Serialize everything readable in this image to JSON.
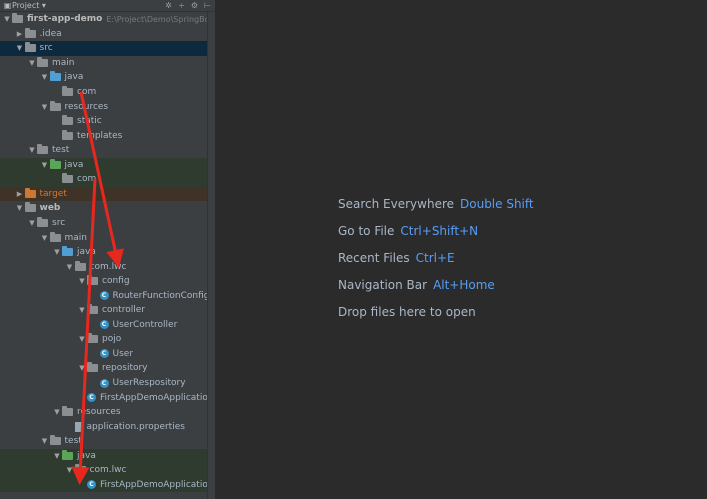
{
  "panel": {
    "title": "Project",
    "toolbar_icons": [
      "settings-icon",
      "collapse-icon",
      "gear-icon",
      "hide-icon"
    ]
  },
  "tree": [
    {
      "label": "first-app-demo",
      "path": "E:\\Project\\Demo\\SpringBoot\\",
      "depth": 0,
      "arrow": "down",
      "icon": "module",
      "bold": true
    },
    {
      "label": ".idea",
      "depth": 1,
      "arrow": "right",
      "icon": "folder"
    },
    {
      "label": "src",
      "depth": 1,
      "arrow": "down",
      "icon": "folder",
      "selected": true
    },
    {
      "label": "main",
      "depth": 2,
      "arrow": "down",
      "icon": "folder"
    },
    {
      "label": "java",
      "depth": 3,
      "arrow": "down",
      "icon": "folder-blue"
    },
    {
      "label": "com",
      "depth": 4,
      "arrow": "none",
      "icon": "package"
    },
    {
      "label": "resources",
      "depth": 3,
      "arrow": "down",
      "icon": "folder-res"
    },
    {
      "label": "static",
      "depth": 4,
      "arrow": "none",
      "icon": "folder"
    },
    {
      "label": "templates",
      "depth": 4,
      "arrow": "none",
      "icon": "folder"
    },
    {
      "label": "test",
      "depth": 2,
      "arrow": "down",
      "icon": "folder"
    },
    {
      "label": "java",
      "depth": 3,
      "arrow": "down",
      "icon": "folder-green",
      "tested": true
    },
    {
      "label": "com",
      "depth": 4,
      "arrow": "none",
      "icon": "package",
      "tested": true
    },
    {
      "label": "target",
      "depth": 1,
      "arrow": "right",
      "icon": "folder-orange",
      "excluded": true
    },
    {
      "label": "web",
      "depth": 1,
      "arrow": "down",
      "icon": "module",
      "bold": true
    },
    {
      "label": "src",
      "depth": 2,
      "arrow": "down",
      "icon": "folder"
    },
    {
      "label": "main",
      "depth": 3,
      "arrow": "down",
      "icon": "folder"
    },
    {
      "label": "java",
      "depth": 4,
      "arrow": "down",
      "icon": "folder-blue"
    },
    {
      "label": "com.lwc",
      "depth": 5,
      "arrow": "down",
      "icon": "package"
    },
    {
      "label": "config",
      "depth": 6,
      "arrow": "down",
      "icon": "package"
    },
    {
      "label": "RouterFunctionConfiguration",
      "depth": 7,
      "arrow": "none",
      "icon": "class"
    },
    {
      "label": "controller",
      "depth": 6,
      "arrow": "down",
      "icon": "package"
    },
    {
      "label": "UserController",
      "depth": 7,
      "arrow": "none",
      "icon": "class"
    },
    {
      "label": "pojo",
      "depth": 6,
      "arrow": "down",
      "icon": "package"
    },
    {
      "label": "User",
      "depth": 7,
      "arrow": "none",
      "icon": "class"
    },
    {
      "label": "repository",
      "depth": 6,
      "arrow": "down",
      "icon": "package"
    },
    {
      "label": "UserRespository",
      "depth": 7,
      "arrow": "none",
      "icon": "class"
    },
    {
      "label": "FirstAppDemoApplication",
      "depth": 6,
      "arrow": "none",
      "icon": "class"
    },
    {
      "label": "resources",
      "depth": 4,
      "arrow": "down",
      "icon": "folder-res"
    },
    {
      "label": "application.properties",
      "depth": 5,
      "arrow": "none",
      "icon": "file"
    },
    {
      "label": "test",
      "depth": 3,
      "arrow": "down",
      "icon": "folder"
    },
    {
      "label": "java",
      "depth": 4,
      "arrow": "down",
      "icon": "folder-green",
      "tested": true
    },
    {
      "label": "com.lwc",
      "depth": 5,
      "arrow": "down",
      "icon": "package",
      "tested": true
    },
    {
      "label": "FirstAppDemoApplicationTests",
      "depth": 6,
      "arrow": "none",
      "icon": "class",
      "tested": true
    }
  ],
  "hints": [
    {
      "text": "Search Everywhere",
      "key": "Double Shift"
    },
    {
      "text": "Go to File",
      "key": "Ctrl+Shift+N"
    },
    {
      "text": "Recent Files",
      "key": "Ctrl+E"
    },
    {
      "text": "Navigation Bar",
      "key": "Alt+Home"
    },
    {
      "text": "Drop files here to open",
      "key": ""
    }
  ],
  "colors": {
    "panel_bg": "#3c3f41",
    "editor_bg": "#2b2b2b",
    "accent_key": "#589df6",
    "selection": "#0d293e",
    "annotation_arrow": "#e8281e"
  }
}
